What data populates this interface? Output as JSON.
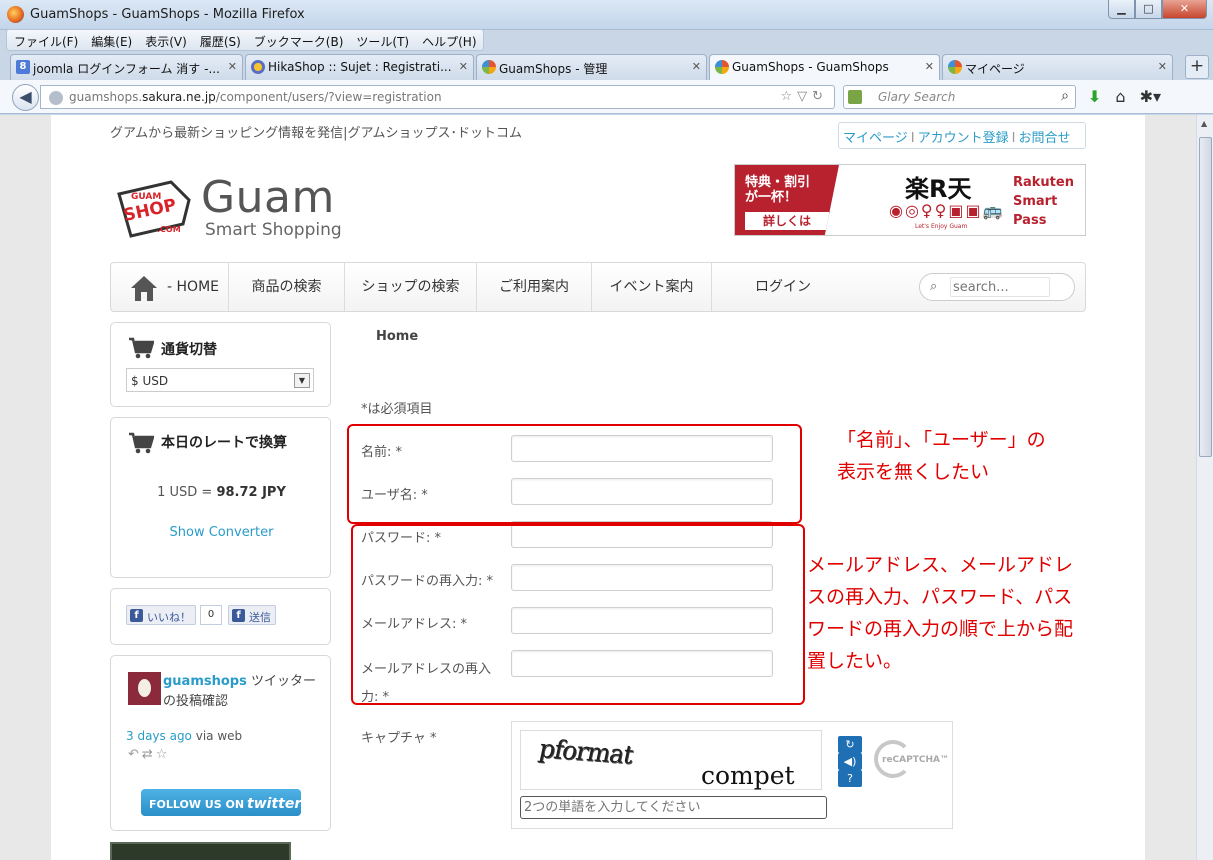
{
  "window": {
    "title": "GuamShops - GuamShops - Mozilla Firefox",
    "controls": {
      "minimize": "▁",
      "maximize": "□",
      "close": "✕"
    }
  },
  "menu": [
    "ファイル(F)",
    "編集(E)",
    "表示(V)",
    "履歴(S)",
    "ブックマーク(B)",
    "ツール(T)",
    "ヘルプ(H)"
  ],
  "tabs": [
    {
      "label": "joomla ログインフォーム 消す -...",
      "icon": "google-icon",
      "active": false
    },
    {
      "label": "HikaShop :: Sujet : Registrati...",
      "icon": "hikashop-icon",
      "active": false
    },
    {
      "label": "GuamShops - 管理",
      "icon": "joomla-icon",
      "active": false
    },
    {
      "label": "GuamShops - GuamShops",
      "icon": "joomla-icon",
      "active": true
    },
    {
      "label": "マイページ",
      "icon": "joomla-icon",
      "active": false
    }
  ],
  "newtab": "+",
  "url": {
    "prefix": "guamshops.",
    "host": "sakura.ne.jp",
    "path": "/component/users/?view=registration"
  },
  "search_engine": {
    "placeholder": "Glary Search"
  },
  "site": {
    "tagline": "グアムから最新ショッピング情報を発信|グアムショップス･ドットコム",
    "toplinks": [
      "マイページ",
      "アカウント登録",
      "お問合せ"
    ],
    "logo": {
      "tag_top": "GUAM",
      "tag_mid": "SHOP",
      "tag_bot": ".COM",
      "word": "Guam",
      "sub": "Smart Shopping"
    },
    "banner": {
      "line1": "特典・割引",
      "line2": "が一杯！",
      "button": "詳しくは",
      "brand": "楽R天",
      "enjoy": "Let's Enjoy Guam",
      "product": [
        "Rakuten",
        "Smart",
        "Pass"
      ]
    },
    "nav": [
      "HOME",
      "商品の検索",
      "ショップの検索",
      "ご利用案内",
      "イベント案内",
      "ログイン"
    ],
    "nav_search_placeholder": "search..."
  },
  "sidebar": {
    "currency": {
      "title": "通貨切替",
      "selected": "$ USD"
    },
    "converter": {
      "title": "本日のレートで換算",
      "rate_prefix": "1 USD = ",
      "rate_value": "98.72 JPY",
      "link": "Show Converter"
    },
    "facebook": {
      "like": "いいね！",
      "count": "0",
      "send": "送信"
    },
    "twitter": {
      "user": "guamshops",
      "text": " ツイッターの投稿確認",
      "time": "3 days ago",
      "via": " via web",
      "follow": "FOLLOW US ON",
      "brand": "twitter"
    }
  },
  "form": {
    "breadcrumb": "Home",
    "required_note": "*は必須項目",
    "fields": [
      {
        "label": "名前: *"
      },
      {
        "label": "ユーザ名: *"
      },
      {
        "label": "パスワード: *"
      },
      {
        "label": "パスワードの再入力: *"
      },
      {
        "label": "メールアドレス: *"
      },
      {
        "label_l1": "メールアドレスの再入",
        "label_l2": "力: *"
      }
    ],
    "captcha": {
      "label": "キャプチャ *",
      "word1": "pformat",
      "word2": "compet",
      "placeholder": "2つの単語を入力してください",
      "logo": "reCAPTCHA™"
    }
  },
  "annotations": {
    "first": [
      "「名前」、「ユーザー」の",
      "表示を無くしたい"
    ],
    "second": [
      "メールアドレス、メールアドレ",
      "スの再入力、パスワード、パス",
      "ワードの再入力の順で上から配",
      "置したい。"
    ]
  },
  "colors": {
    "accent_link": "#2a9cc9",
    "annotation_red": "#e00000",
    "brand_red": "#b8222f"
  }
}
